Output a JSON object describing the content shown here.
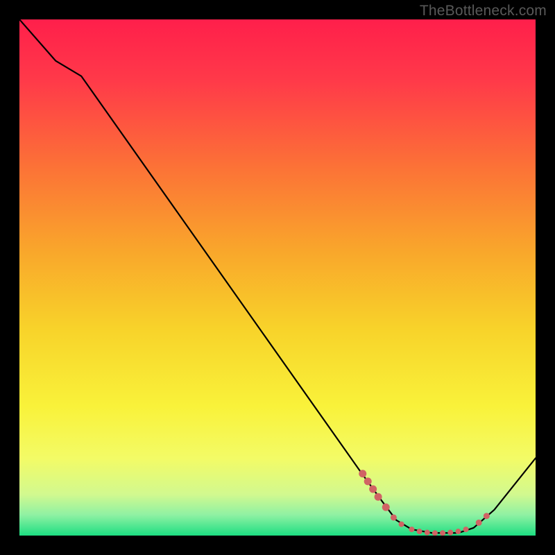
{
  "watermark": "TheBottleneck.com",
  "chart_data": {
    "type": "line",
    "title": "",
    "xlabel": "",
    "ylabel": "",
    "xlim": [
      0,
      100
    ],
    "ylim": [
      0,
      100
    ],
    "grid": false,
    "legend": false,
    "curve": [
      {
        "x": 0,
        "y": 100
      },
      {
        "x": 7,
        "y": 92
      },
      {
        "x": 12,
        "y": 89
      },
      {
        "x": 66,
        "y": 12.5
      },
      {
        "x": 70,
        "y": 7
      },
      {
        "x": 73,
        "y": 3
      },
      {
        "x": 76,
        "y": 1.2
      },
      {
        "x": 80,
        "y": 0.5
      },
      {
        "x": 85,
        "y": 0.5
      },
      {
        "x": 88,
        "y": 1.5
      },
      {
        "x": 92,
        "y": 5
      },
      {
        "x": 100,
        "y": 15
      }
    ],
    "markers": [
      {
        "x": 66.5,
        "y": 12.0,
        "r": 5.5
      },
      {
        "x": 67.5,
        "y": 10.5,
        "r": 5.5
      },
      {
        "x": 68.5,
        "y": 9,
        "r": 5.5
      },
      {
        "x": 69.5,
        "y": 7.5,
        "r": 5.5
      },
      {
        "x": 71.0,
        "y": 5.5,
        "r": 5.5
      },
      {
        "x": 72.5,
        "y": 3.5,
        "r": 4.5
      },
      {
        "x": 74.0,
        "y": 2.2,
        "r": 4.0
      },
      {
        "x": 76.0,
        "y": 1.2,
        "r": 4.0
      },
      {
        "x": 77.5,
        "y": 0.8,
        "r": 4.0
      },
      {
        "x": 79.0,
        "y": 0.6,
        "r": 4.0
      },
      {
        "x": 80.5,
        "y": 0.5,
        "r": 4.0
      },
      {
        "x": 82.0,
        "y": 0.5,
        "r": 4.0
      },
      {
        "x": 83.5,
        "y": 0.6,
        "r": 4.0
      },
      {
        "x": 85.0,
        "y": 0.8,
        "r": 4.0
      },
      {
        "x": 86.5,
        "y": 1.2,
        "r": 4.0
      },
      {
        "x": 89.0,
        "y": 2.5,
        "r": 4.5
      },
      {
        "x": 90.5,
        "y": 3.8,
        "r": 4.5
      }
    ],
    "gradient_stops": [
      {
        "offset": 0,
        "color": "#ff1f4b"
      },
      {
        "offset": 12,
        "color": "#ff3a49"
      },
      {
        "offset": 28,
        "color": "#fc7037"
      },
      {
        "offset": 45,
        "color": "#f9a72b"
      },
      {
        "offset": 60,
        "color": "#f8d32a"
      },
      {
        "offset": 75,
        "color": "#f9f23a"
      },
      {
        "offset": 85,
        "color": "#f3fb66"
      },
      {
        "offset": 92,
        "color": "#d2f98f"
      },
      {
        "offset": 96,
        "color": "#8ff1a3"
      },
      {
        "offset": 100,
        "color": "#1dde82"
      }
    ]
  }
}
